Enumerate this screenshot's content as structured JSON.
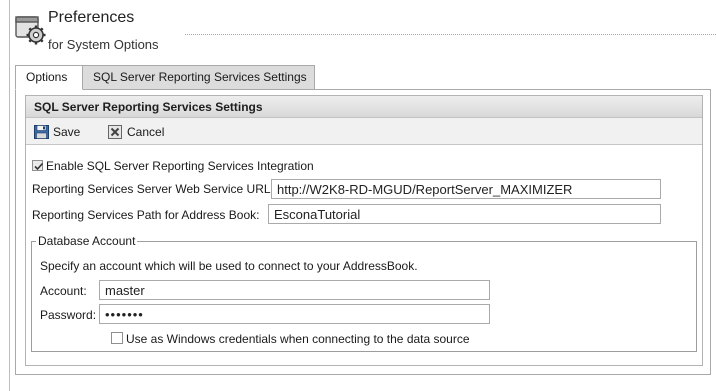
{
  "header": {
    "title": "Preferences",
    "subtitle": "for System Options",
    "icon": "preferences-gear-icon"
  },
  "tabs": [
    {
      "label": "Options",
      "active": true
    },
    {
      "label": "SQL Server Reporting Services Settings",
      "active": false
    }
  ],
  "section": {
    "title": "SQL Server Reporting Services Settings",
    "toolbar": {
      "save_label": "Save",
      "cancel_label": "Cancel"
    },
    "enable_integration": {
      "label": "Enable SQL Server Reporting Services Integration",
      "checked": true
    },
    "web_service_url": {
      "label": "Reporting Services Server Web Service URL:",
      "value": "http://W2K8-RD-MGUD/ReportServer_MAXIMIZER"
    },
    "address_book_path": {
      "label": "Reporting Services Path for Address Book:",
      "value": "EsconaTutorial"
    },
    "database_account": {
      "legend": "Database Account",
      "description": "Specify an account which will be used to connect to your AddressBook.",
      "account": {
        "label": "Account:",
        "value": "master"
      },
      "password": {
        "label": "Password:",
        "value": "•••••••"
      },
      "windows_credentials": {
        "label": "Use as Windows credentials when connecting to the data source",
        "checked": false
      }
    }
  },
  "colors": {
    "tab_inactive": "#dcdcdc",
    "section_header": "#dedede",
    "border": "#a9a9a9"
  }
}
